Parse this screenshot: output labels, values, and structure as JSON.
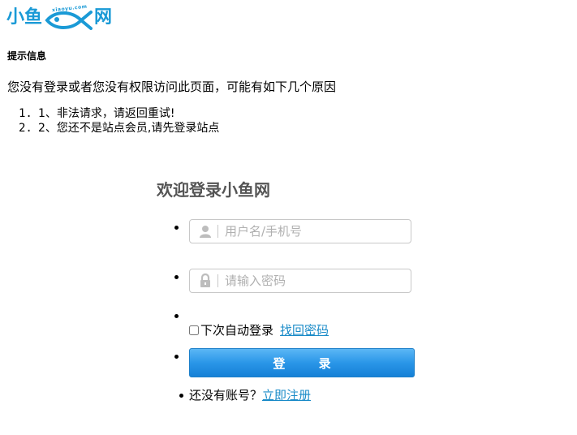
{
  "logo": {
    "left_text": "小鱼",
    "right_text": "网",
    "domain_text": "xiaoyu.com",
    "brand_color": "#1a9ad6"
  },
  "tip": {
    "title": "提示信息",
    "description": "您没有登录或者您没有权限访问此页面，可能有如下几个原因",
    "reasons": [
      {
        "num": "1.",
        "text": "1、非法请求，请返回重试!"
      },
      {
        "num": "2.",
        "text": "2、您还不是站点会员,请先登录站点"
      }
    ]
  },
  "login": {
    "title": "欢迎登录小鱼网",
    "username_placeholder": "用户名/手机号",
    "password_placeholder": "请输入密码",
    "remember_label": "下次自动登录",
    "forgot_link": "找回密码",
    "submit_label": "登 录",
    "no_account_text": "还没有账号？",
    "register_link": "立即注册",
    "link_color": "#1a8bc8",
    "button_color": "#2a96e8"
  }
}
